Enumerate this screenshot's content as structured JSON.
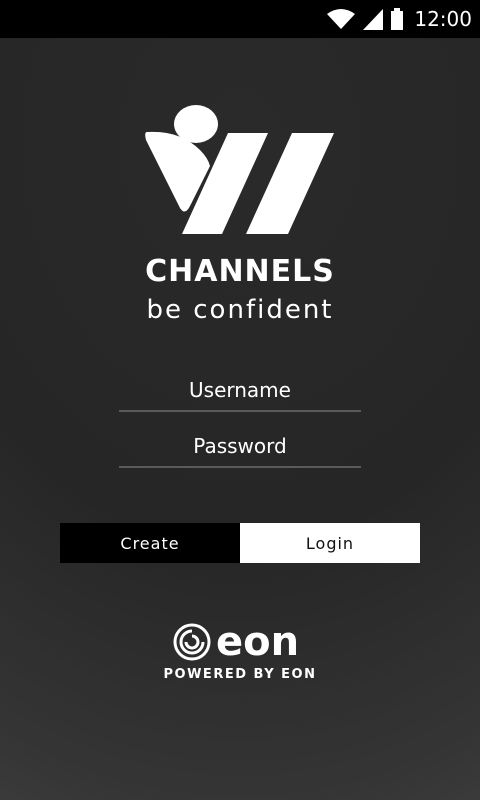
{
  "status_bar": {
    "time": "12:00",
    "icons": [
      "wifi-icon",
      "cellular-signal-icon",
      "battery-icon"
    ]
  },
  "brand": {
    "logo_icon": "channels-logo-icon",
    "title": "CHANNELS",
    "tagline": "be confident"
  },
  "form": {
    "username_placeholder": "Username",
    "username_value": "",
    "password_placeholder": "Password",
    "password_value": ""
  },
  "buttons": {
    "create_label": "Create",
    "login_label": "Login"
  },
  "footer": {
    "logo_icon": "eon-logo-icon",
    "logo_text": "eon",
    "powered_by": "POWERED BY EON"
  },
  "colors": {
    "background": "#262626",
    "text": "#ffffff",
    "create_button_bg": "#000000",
    "login_button_bg": "#ffffff"
  }
}
